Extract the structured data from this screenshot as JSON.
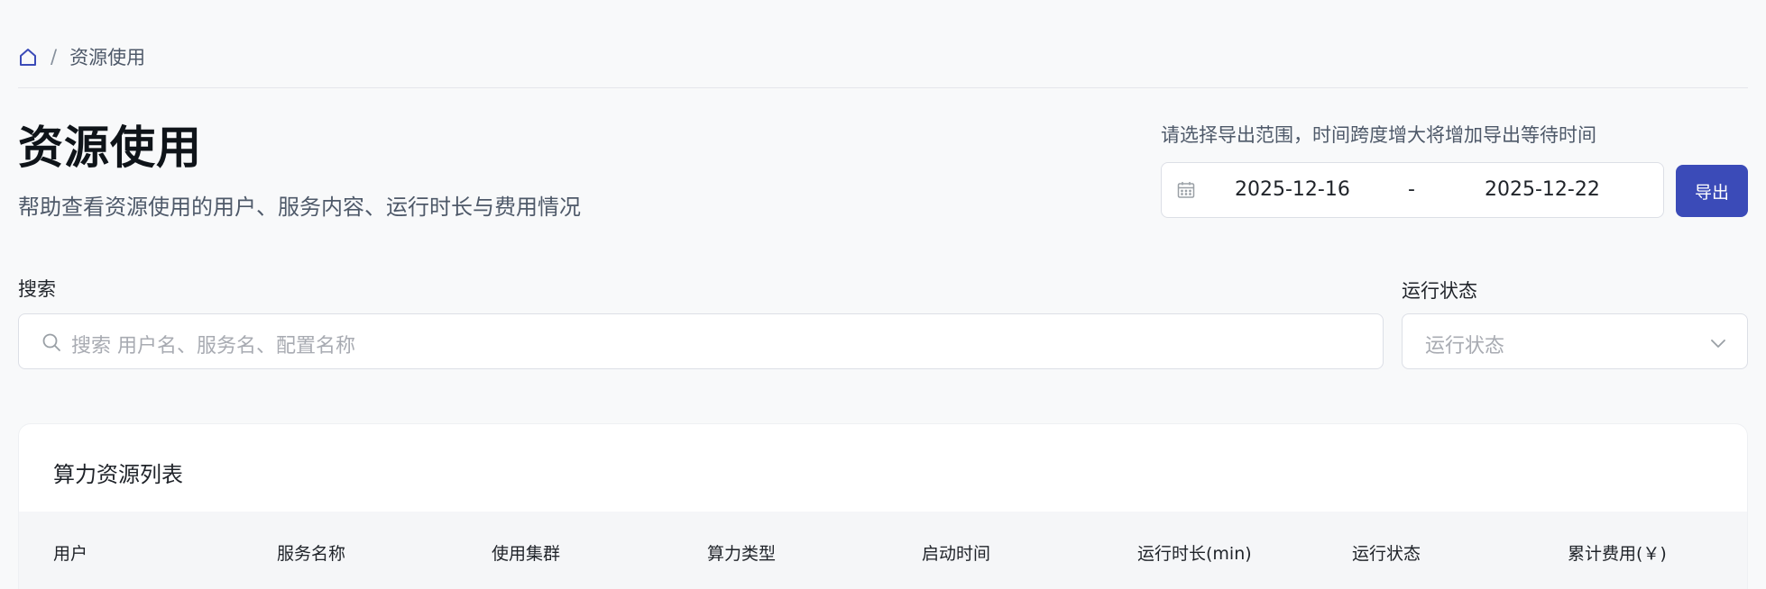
{
  "breadcrumb": {
    "home_icon": "home-icon",
    "separator": "/",
    "current": "资源使用"
  },
  "header": {
    "title": "资源使用",
    "subtitle": "帮助查看资源使用的用户、服务内容、运行时长与费用情况"
  },
  "export": {
    "hint": "请选择导出范围，时间跨度增大将增加导出等待时间",
    "date_icon": "calendar-icon",
    "start_date": "2025-12-16",
    "range_separator": "-",
    "end_date": "2025-12-22",
    "button_label": "导出",
    "accent_color": "#3b4bb8"
  },
  "filters": {
    "search_label": "搜索",
    "search_icon": "search-icon",
    "search_placeholder": "搜索 用户名、服务名、配置名称",
    "status_label": "运行状态",
    "status_placeholder": "运行状态",
    "status_icon": "chevron-down-icon"
  },
  "table": {
    "title": "算力资源列表",
    "columns": [
      "用户",
      "服务名称",
      "使用集群",
      "算力类型",
      "启动时间",
      "运行时长(min)",
      "运行状态",
      "累计费用(￥)"
    ]
  }
}
